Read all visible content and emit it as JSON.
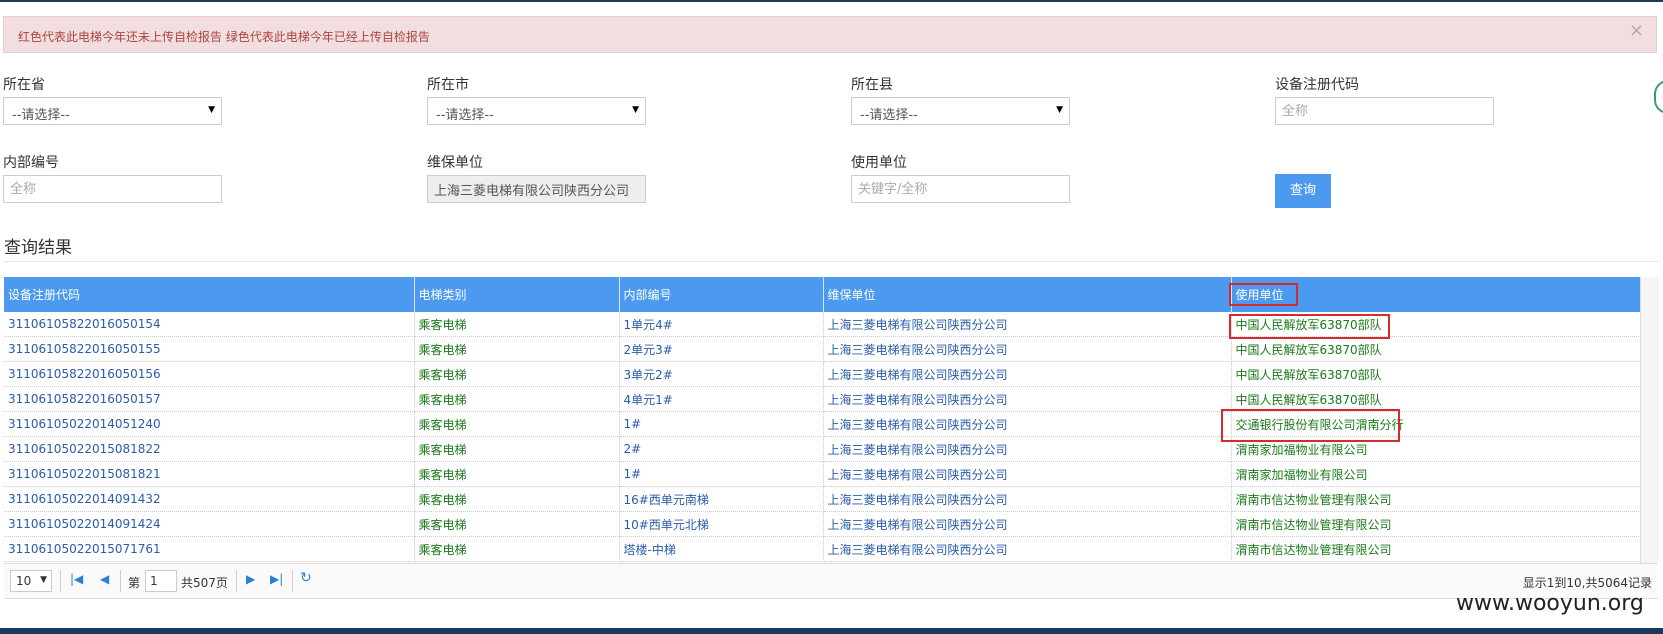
{
  "alert": {
    "message": "红色代表此电梯今年还未上传自检报告  绿色代表此电梯今年已经上传自检报告",
    "close": "×"
  },
  "filters": {
    "province": {
      "label": "所在省",
      "value": "--请选择--"
    },
    "city": {
      "label": "所在市",
      "value": "--请选择--"
    },
    "county": {
      "label": "所在县",
      "value": "--请选择--"
    },
    "reg_code": {
      "label": "设备注册代码",
      "placeholder": "全称"
    },
    "internal_no": {
      "label": "内部编号",
      "placeholder": "全称"
    },
    "maintenance_unit": {
      "label": "维保单位",
      "value": "上海三菱电梯有限公司陕西分公司"
    },
    "user_unit": {
      "label": "使用单位",
      "placeholder": "关键字/全称"
    },
    "query_button": "查询"
  },
  "results": {
    "title": "查询结果",
    "columns": [
      "设备注册代码",
      "电梯类别",
      "内部编号",
      "维保单位",
      "使用单位"
    ],
    "rows": [
      [
        "31106105822016050154",
        "乘客电梯",
        "1单元4#",
        "上海三菱电梯有限公司陕西分公司",
        "中国人民解放军63870部队"
      ],
      [
        "31106105822016050155",
        "乘客电梯",
        "2单元3#",
        "上海三菱电梯有限公司陕西分公司",
        "中国人民解放军63870部队"
      ],
      [
        "31106105822016050156",
        "乘客电梯",
        "3单元2#",
        "上海三菱电梯有限公司陕西分公司",
        "中国人民解放军63870部队"
      ],
      [
        "31106105822016050157",
        "乘客电梯",
        "4单元1#",
        "上海三菱电梯有限公司陕西分公司",
        "中国人民解放军63870部队"
      ],
      [
        "31106105022014051240",
        "乘客电梯",
        "1#",
        "上海三菱电梯有限公司陕西分公司",
        "交通银行股份有限公司渭南分行"
      ],
      [
        "31106105022015081822",
        "乘客电梯",
        "2#",
        "上海三菱电梯有限公司陕西分公司",
        "渭南家加福物业有限公司"
      ],
      [
        "31106105022015081821",
        "乘客电梯",
        "1#",
        "上海三菱电梯有限公司陕西分公司",
        "渭南家加福物业有限公司"
      ],
      [
        "31106105022014091432",
        "乘客电梯",
        "16#西单元南梯",
        "上海三菱电梯有限公司陕西分公司",
        "渭南市信达物业管理有限公司"
      ],
      [
        "31106105022014091424",
        "乘客电梯",
        "10#西单元北梯",
        "上海三菱电梯有限公司陕西分公司",
        "渭南市信达物业管理有限公司"
      ],
      [
        "31106105022015071761",
        "乘客电梯",
        "塔楼-中梯",
        "上海三菱电梯有限公司陕西分公司",
        "渭南市信达物业管理有限公司"
      ]
    ]
  },
  "pager": {
    "page_size": "10",
    "page_label": "第",
    "current_page": "1",
    "total_pages": "共507页",
    "info": "显示1到10,共5064记录"
  },
  "watermark": "www.wooyun.org",
  "colors": {
    "accent": "#4c9af0",
    "green_status": "#1a7a1a",
    "annotation_red": "#d62b2b"
  },
  "icons": [
    "close-icon",
    "caret-down-icon",
    "first-page-icon",
    "prev-page-icon",
    "next-page-icon",
    "last-page-icon",
    "refresh-icon"
  ]
}
